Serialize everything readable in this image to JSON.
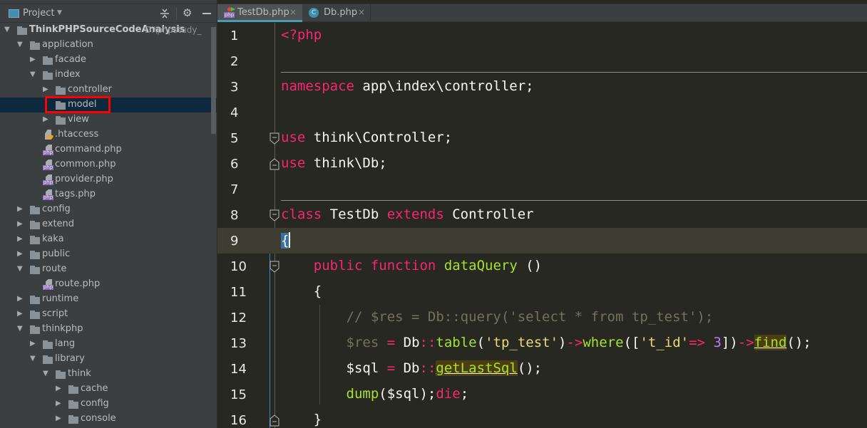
{
  "project_panel": {
    "title": "Project",
    "items": [
      {
        "label": "ThinkPHPSourceCodeAnalysis",
        "path": "D:\\phpstudy_",
        "type": "folder",
        "depth": 0,
        "expanded": true,
        "bold": true
      },
      {
        "label": "application",
        "type": "folder",
        "depth": 1,
        "expanded": true
      },
      {
        "label": "facade",
        "type": "folder",
        "depth": 2,
        "expanded": false
      },
      {
        "label": "index",
        "type": "folder",
        "depth": 2,
        "expanded": true
      },
      {
        "label": "controller",
        "type": "folder",
        "depth": 3,
        "expanded": false
      },
      {
        "label": "model",
        "type": "folder",
        "depth": 3,
        "selected": true,
        "highlighted": true
      },
      {
        "label": "view",
        "type": "folder",
        "depth": 3,
        "expanded": false
      },
      {
        "label": ".htaccess",
        "type": "htaccess",
        "depth": 2
      },
      {
        "label": "command.php",
        "type": "php",
        "depth": 2
      },
      {
        "label": "common.php",
        "type": "php",
        "depth": 2
      },
      {
        "label": "provider.php",
        "type": "php",
        "depth": 2
      },
      {
        "label": "tags.php",
        "type": "php",
        "depth": 2
      },
      {
        "label": "config",
        "type": "folder",
        "depth": 1,
        "expanded": false
      },
      {
        "label": "extend",
        "type": "folder",
        "depth": 1,
        "expanded": false
      },
      {
        "label": "kaka",
        "type": "folder",
        "depth": 1,
        "expanded": false
      },
      {
        "label": "public",
        "type": "folder",
        "depth": 1,
        "expanded": false
      },
      {
        "label": "route",
        "type": "folder",
        "depth": 1,
        "expanded": true
      },
      {
        "label": "route.php",
        "type": "php",
        "depth": 2
      },
      {
        "label": "runtime",
        "type": "folder",
        "depth": 1,
        "expanded": false
      },
      {
        "label": "script",
        "type": "folder",
        "depth": 1,
        "expanded": false
      },
      {
        "label": "thinkphp",
        "type": "folder",
        "depth": 1,
        "expanded": true
      },
      {
        "label": "lang",
        "type": "folder",
        "depth": 2,
        "expanded": false
      },
      {
        "label": "library",
        "type": "folder",
        "depth": 2,
        "expanded": true
      },
      {
        "label": "think",
        "type": "folder",
        "depth": 3,
        "expanded": true
      },
      {
        "label": "cache",
        "type": "folder",
        "depth": 4,
        "expanded": false
      },
      {
        "label": "config",
        "type": "folder",
        "depth": 4,
        "expanded": false
      },
      {
        "label": "console",
        "type": "folder",
        "depth": 4,
        "expanded": false
      }
    ]
  },
  "tabs": [
    {
      "label": "TestDb.php",
      "icon": "php-class-icon",
      "active": true,
      "close": "×"
    },
    {
      "label": "Db.php",
      "icon": "class-icon",
      "active": false,
      "close": "×",
      "icon_glyph": "C"
    }
  ],
  "editor": {
    "current_line": 9,
    "lines": [
      {
        "n": "1",
        "tokens": [
          {
            "t": "<?php",
            "c": "kw"
          }
        ]
      },
      {
        "n": "2",
        "tokens": []
      },
      {
        "n": "3",
        "tokens": [
          {
            "t": "namespace",
            "c": "kw"
          },
          {
            "t": " app\\index\\controller;",
            "c": ""
          }
        ]
      },
      {
        "n": "4",
        "tokens": []
      },
      {
        "n": "5",
        "tokens": [
          {
            "t": "use",
            "c": "kw"
          },
          {
            "t": " think\\Controller;",
            "c": ""
          }
        ]
      },
      {
        "n": "6",
        "tokens": [
          {
            "t": "use",
            "c": "kw"
          },
          {
            "t": " think\\Db;",
            "c": ""
          }
        ]
      },
      {
        "n": "7",
        "tokens": []
      },
      {
        "n": "8",
        "tokens": [
          {
            "t": "class",
            "c": "kw"
          },
          {
            "t": " TestDb ",
            "c": ""
          },
          {
            "t": "extends",
            "c": "kw"
          },
          {
            "t": " Controller",
            "c": ""
          }
        ]
      },
      {
        "n": "9",
        "tokens": [
          {
            "t": "{",
            "c": "brace-sel"
          },
          {
            "t": "",
            "c": "caret"
          }
        ]
      },
      {
        "n": "10",
        "tokens": [
          {
            "t": "    ",
            "c": ""
          },
          {
            "t": "public",
            "c": "kw"
          },
          {
            "t": " ",
            "c": ""
          },
          {
            "t": "function",
            "c": "kw"
          },
          {
            "t": " ",
            "c": ""
          },
          {
            "t": "dataQuery",
            "c": "fn"
          },
          {
            "t": " ()",
            "c": ""
          }
        ]
      },
      {
        "n": "11",
        "tokens": [
          {
            "t": "    {",
            "c": ""
          }
        ]
      },
      {
        "n": "12",
        "tokens": [
          {
            "t": "        // $res = Db::query('select * from tp_test');",
            "c": "cm"
          }
        ]
      },
      {
        "n": "13",
        "tokens": [
          {
            "t": "        ",
            "c": ""
          },
          {
            "t": "$res",
            "c": "cm"
          },
          {
            "t": " ",
            "c": ""
          },
          {
            "t": "=",
            "c": "op"
          },
          {
            "t": " Db",
            "c": ""
          },
          {
            "t": "::",
            "c": "op"
          },
          {
            "t": "table",
            "c": "fn"
          },
          {
            "t": "(",
            "c": ""
          },
          {
            "t": "'tp_test'",
            "c": "str"
          },
          {
            "t": ")",
            "c": ""
          },
          {
            "t": "->",
            "c": "op"
          },
          {
            "t": "where",
            "c": "fn"
          },
          {
            "t": "([",
            "c": ""
          },
          {
            "t": "'t_id'",
            "c": "str"
          },
          {
            "t": "=>",
            "c": "op"
          },
          {
            "t": " ",
            "c": ""
          },
          {
            "t": "3",
            "c": "num"
          },
          {
            "t": "])",
            "c": ""
          },
          {
            "t": "->",
            "c": "op"
          },
          {
            "t": "find",
            "c": "fn hl"
          },
          {
            "t": "();",
            "c": ""
          }
        ]
      },
      {
        "n": "14",
        "tokens": [
          {
            "t": "        $sql ",
            "c": ""
          },
          {
            "t": "=",
            "c": "op"
          },
          {
            "t": " Db",
            "c": ""
          },
          {
            "t": "::",
            "c": "op"
          },
          {
            "t": "getLastSql",
            "c": "fn hl"
          },
          {
            "t": "();",
            "c": ""
          }
        ]
      },
      {
        "n": "15",
        "tokens": [
          {
            "t": "        ",
            "c": ""
          },
          {
            "t": "dump",
            "c": "fn"
          },
          {
            "t": "($sql);",
            "c": ""
          },
          {
            "t": "die",
            "c": "kw"
          },
          {
            "t": ";",
            "c": ""
          }
        ]
      },
      {
        "n": "16",
        "tokens": [
          {
            "t": "    }",
            "c": ""
          }
        ]
      }
    ]
  }
}
